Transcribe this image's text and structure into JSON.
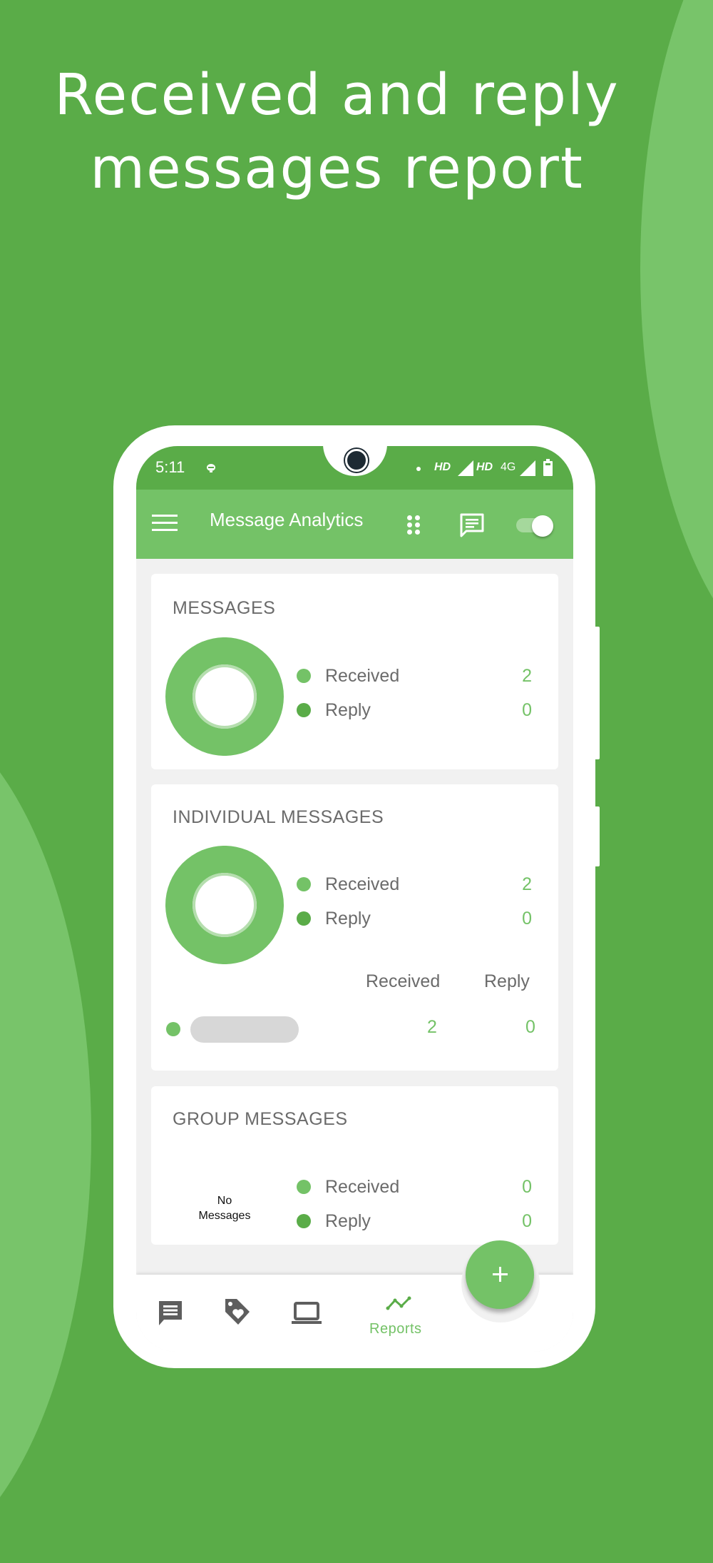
{
  "headline": {
    "line1": "Received and reply",
    "line2": "messages report"
  },
  "status_bar": {
    "time": "5:11",
    "network_1": "HD",
    "network_2": "HD",
    "network_3": "4G"
  },
  "app_bar": {
    "title": "Message Analytics",
    "toggle_on": true
  },
  "colors": {
    "received": "#74c267",
    "reply": "#5aac48",
    "accent": "#74c267",
    "background": "#5aac48"
  },
  "cards": {
    "messages": {
      "title": "MESSAGES",
      "legend": [
        {
          "label": "Received",
          "value": "2"
        },
        {
          "label": "Reply",
          "value": "0"
        }
      ]
    },
    "individual": {
      "title": "INDIVIDUAL MESSAGES",
      "legend": [
        {
          "label": "Received",
          "value": "2"
        },
        {
          "label": "Reply",
          "value": "0"
        }
      ],
      "table_headers": [
        "Received",
        "Reply"
      ],
      "rows": [
        {
          "name_redacted": true,
          "received": "2",
          "reply": "0"
        }
      ]
    },
    "group": {
      "title": "GROUP MESSAGES",
      "empty_text_1": "No",
      "empty_text_2": "Messages",
      "legend": [
        {
          "label": "Received",
          "value": "0"
        },
        {
          "label": "Reply",
          "value": "0"
        }
      ]
    }
  },
  "chart_data": [
    {
      "type": "pie",
      "title": "MESSAGES",
      "categories": [
        "Received",
        "Reply"
      ],
      "values": [
        2,
        0
      ],
      "donut": true
    },
    {
      "type": "pie",
      "title": "INDIVIDUAL MESSAGES",
      "categories": [
        "Received",
        "Reply"
      ],
      "values": [
        2,
        0
      ],
      "donut": true
    },
    {
      "type": "pie",
      "title": "GROUP MESSAGES",
      "categories": [
        "Received",
        "Reply"
      ],
      "values": [
        0,
        0
      ],
      "donut": true,
      "empty_label": "No Messages"
    }
  ],
  "bottom_nav": {
    "items": [
      {
        "icon": "chat-icon",
        "label": ""
      },
      {
        "icon": "tag-heart-icon",
        "label": ""
      },
      {
        "icon": "laptop-icon",
        "label": ""
      },
      {
        "icon": "trending-icon",
        "label": "Reports",
        "active": true
      }
    ],
    "fab_icon": "plus-icon"
  }
}
